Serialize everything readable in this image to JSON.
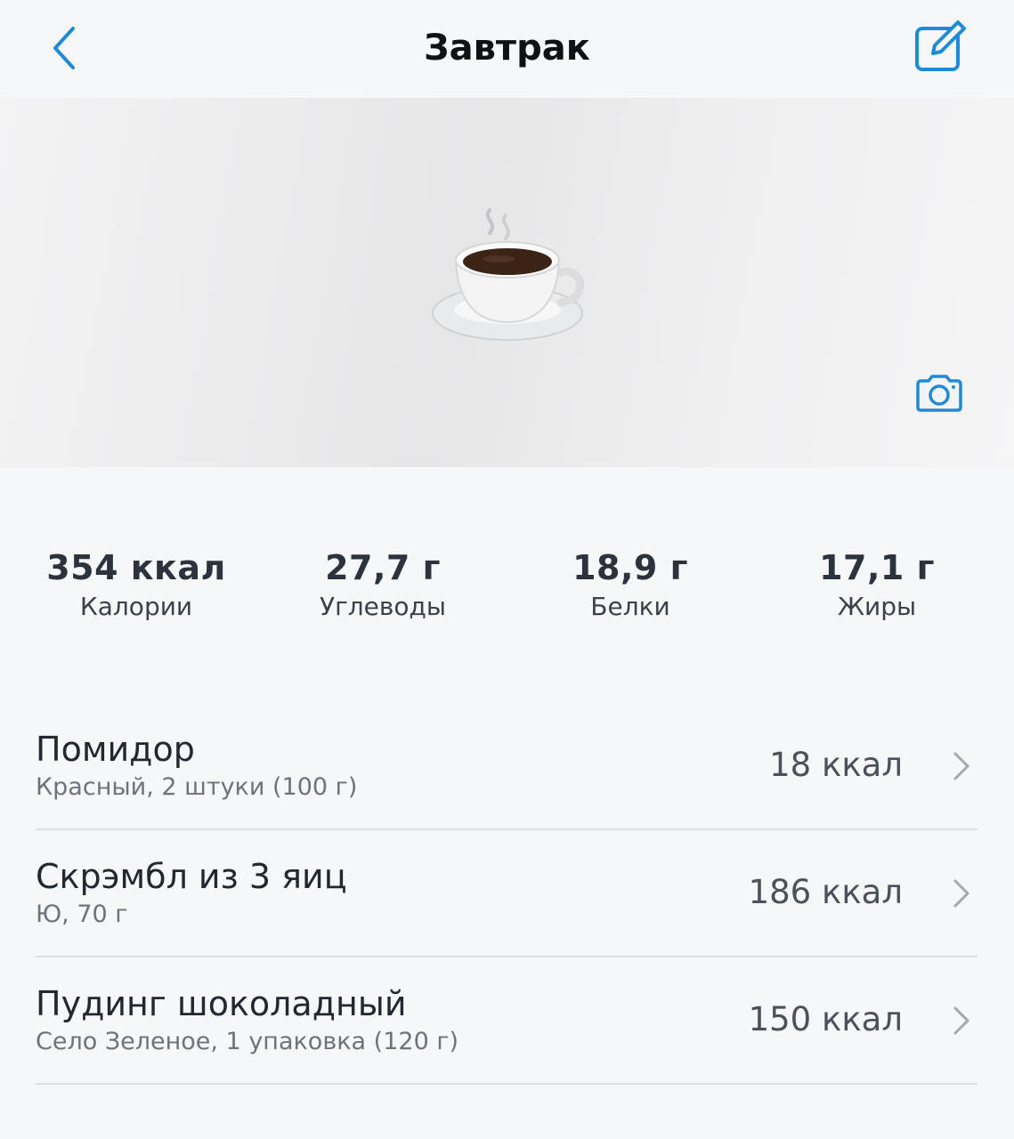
{
  "header": {
    "title": "Завтрак",
    "back_icon": "chevron-left-icon",
    "edit_icon": "edit-square-icon"
  },
  "hero": {
    "image": "coffee-cup-icon",
    "camera_icon": "camera-icon"
  },
  "stats": [
    {
      "value": "354 ккал",
      "label": "Калории"
    },
    {
      "value": "27,7 г",
      "label": "Углеводы"
    },
    {
      "value": "18,9 г",
      "label": "Белки"
    },
    {
      "value": "17,1 г",
      "label": "Жиры"
    }
  ],
  "items": [
    {
      "name": "Помидор",
      "details": "Красный, 2 штуки (100 г)",
      "kcal": "18 ккал"
    },
    {
      "name": "Скрэмбл из 3 яиц",
      "details": "Ю, 70 г",
      "kcal": "186 ккал"
    },
    {
      "name": "Пудинг шоколадный",
      "details": "Село Зеленое, 1 упаковка (120 г)",
      "kcal": "150 ккал"
    }
  ],
  "colors": {
    "accent": "#1f8ad6",
    "background": "#f6f7f9",
    "divider": "#dcdfe3"
  }
}
